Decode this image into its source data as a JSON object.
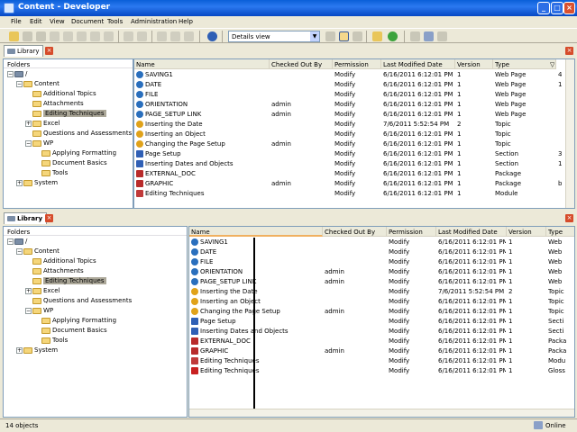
{
  "window": {
    "title": "Content - Developer"
  },
  "menu": [
    "File",
    "Edit",
    "View",
    "Document",
    "Tools",
    "Administration",
    "Help"
  ],
  "toolbar": {
    "view_select": "Details view"
  },
  "library_tab": "Library",
  "folders_header": "Folders",
  "tree": [
    {
      "label": "/",
      "level": 0,
      "expander": "−",
      "icon": "library"
    },
    {
      "label": "Content",
      "level": 1,
      "expander": "−",
      "icon": "folder"
    },
    {
      "label": "Additional Topics",
      "level": 2,
      "expander": "",
      "icon": "folder"
    },
    {
      "label": "Attachments",
      "level": 2,
      "expander": "",
      "icon": "folder"
    },
    {
      "label": "Editing Techniques",
      "level": 2,
      "expander": "",
      "icon": "folder",
      "selected": true
    },
    {
      "label": "Excel",
      "level": 2,
      "expander": "+",
      "icon": "folder"
    },
    {
      "label": "Questions and Assessments",
      "level": 2,
      "expander": "",
      "icon": "folder"
    },
    {
      "label": "WP",
      "level": 2,
      "expander": "−",
      "icon": "folder"
    },
    {
      "label": "Applying Formatting",
      "level": 3,
      "expander": "",
      "icon": "folder"
    },
    {
      "label": "Document Basics",
      "level": 3,
      "expander": "",
      "icon": "folder"
    },
    {
      "label": "Tools",
      "level": 3,
      "expander": "",
      "icon": "folder"
    },
    {
      "label": "System",
      "level": 1,
      "expander": "+",
      "icon": "folder"
    }
  ],
  "columns": [
    "Name",
    "Checked Out By",
    "Permission",
    "Last Modified Date",
    "Version",
    "Type"
  ],
  "rows_top": [
    {
      "name": "SAVING1",
      "checked": "",
      "perm": "Modify",
      "date": "6/16/2011 6:12:01 PM",
      "ver": "1",
      "type": "Web Page",
      "icon": "web",
      "lock": false
    },
    {
      "name": "DATE",
      "checked": "",
      "perm": "Modify",
      "date": "6/16/2011 6:12:01 PM",
      "ver": "1",
      "type": "Web Page",
      "icon": "web",
      "lock": false
    },
    {
      "name": "FILE",
      "checked": "",
      "perm": "Modify",
      "date": "6/16/2011 6:12:01 PM",
      "ver": "1",
      "type": "Web Page",
      "icon": "web",
      "lock": false
    },
    {
      "name": "ORIENTATION",
      "checked": "admin",
      "perm": "Modify",
      "date": "6/16/2011 6:12:01 PM",
      "ver": "1",
      "type": "Web Page",
      "icon": "web",
      "lock": true
    },
    {
      "name": "PAGE_SETUP LINK",
      "checked": "admin",
      "perm": "Modify",
      "date": "6/16/2011 6:12:01 PM",
      "ver": "1",
      "type": "Web Page",
      "icon": "web",
      "lock": true
    },
    {
      "name": "Inserting the Date",
      "checked": "",
      "perm": "Modify",
      "date": "7/6/2011 5:52:54 PM",
      "ver": "2",
      "type": "Topic",
      "icon": "topic",
      "lock": false
    },
    {
      "name": "Inserting an Object",
      "checked": "",
      "perm": "Modify",
      "date": "6/16/2011 6:12:01 PM",
      "ver": "1",
      "type": "Topic",
      "icon": "topic",
      "lock": false
    },
    {
      "name": "Changing the Page Setup",
      "checked": "admin",
      "perm": "Modify",
      "date": "6/16/2011 6:12:01 PM",
      "ver": "1",
      "type": "Topic",
      "icon": "topic",
      "lock": true
    },
    {
      "name": "Page Setup",
      "checked": "",
      "perm": "Modify",
      "date": "6/16/2011 6:12:01 PM",
      "ver": "1",
      "type": "Section",
      "icon": "section",
      "lock": false
    },
    {
      "name": "Inserting Dates and Objects",
      "checked": "",
      "perm": "Modify",
      "date": "6/16/2011 6:12:01 PM",
      "ver": "1",
      "type": "Section",
      "icon": "section",
      "lock": false
    },
    {
      "name": "EXTERNAL_DOC",
      "checked": "",
      "perm": "Modify",
      "date": "6/16/2011 6:12:01 PM",
      "ver": "1",
      "type": "Package",
      "icon": "package",
      "lock": false
    },
    {
      "name": "GRAPHIC",
      "checked": "admin",
      "perm": "Modify",
      "date": "6/16/2011 6:12:01 PM",
      "ver": "1",
      "type": "Package",
      "icon": "package",
      "lock": true
    },
    {
      "name": "Editing Techniques",
      "checked": "",
      "perm": "Modify",
      "date": "6/16/2011 6:12:01 PM",
      "ver": "1",
      "type": "Module",
      "icon": "module",
      "lock": false
    }
  ],
  "right_col_top": [
    "4",
    "1",
    "",
    "",
    "",
    "",
    "",
    "",
    "3",
    "1",
    "",
    "b",
    ""
  ],
  "rows_bottom": [
    {
      "name": "SAVING1",
      "checked": "",
      "perm": "Modify",
      "date": "6/16/2011 6:12:01 PM",
      "ver": "1",
      "type": "Web",
      "icon": "web",
      "lock": false
    },
    {
      "name": "DATE",
      "checked": "",
      "perm": "Modify",
      "date": "6/16/2011 6:12:01 PM",
      "ver": "1",
      "type": "Web",
      "icon": "web",
      "lock": false
    },
    {
      "name": "FILE",
      "checked": "",
      "perm": "Modify",
      "date": "6/16/2011 6:12:01 PM",
      "ver": "1",
      "type": "Web",
      "icon": "web",
      "lock": false
    },
    {
      "name": "ORIENTATION",
      "checked": "admin",
      "perm": "Modify",
      "date": "6/16/2011 6:12:01 PM",
      "ver": "1",
      "type": "Web",
      "icon": "web",
      "lock": true
    },
    {
      "name": "PAGE_SETUP LINK",
      "checked": "admin",
      "perm": "Modify",
      "date": "6/16/2011 6:12:01 PM",
      "ver": "1",
      "type": "Web",
      "icon": "web",
      "lock": true
    },
    {
      "name": "Inserting the Date",
      "checked": "",
      "perm": "Modify",
      "date": "7/6/2011 5:52:54 PM",
      "ver": "2",
      "type": "Topic",
      "icon": "topic",
      "lock": false
    },
    {
      "name": "Inserting an Object",
      "checked": "",
      "perm": "Modify",
      "date": "6/16/2011 6:12:01 PM",
      "ver": "1",
      "type": "Topic",
      "icon": "topic",
      "lock": false
    },
    {
      "name": "Changing the Page Setup",
      "checked": "admin",
      "perm": "Modify",
      "date": "6/16/2011 6:12:01 PM",
      "ver": "1",
      "type": "Topic",
      "icon": "topic",
      "lock": true
    },
    {
      "name": "Page Setup",
      "checked": "",
      "perm": "Modify",
      "date": "6/16/2011 6:12:01 PM",
      "ver": "1",
      "type": "Secti",
      "icon": "section",
      "lock": false
    },
    {
      "name": "Inserting Dates and Objects",
      "checked": "",
      "perm": "Modify",
      "date": "6/16/2011 6:12:01 PM",
      "ver": "1",
      "type": "Secti",
      "icon": "section",
      "lock": false
    },
    {
      "name": "EXTERNAL_DOC",
      "checked": "",
      "perm": "Modify",
      "date": "6/16/2011 6:12:01 PM",
      "ver": "1",
      "type": "Packa",
      "icon": "package",
      "lock": false
    },
    {
      "name": "GRAPHIC",
      "checked": "admin",
      "perm": "Modify",
      "date": "6/16/2011 6:12:01 PM",
      "ver": "1",
      "type": "Packa",
      "icon": "package",
      "lock": true
    },
    {
      "name": "Editing Techniques",
      "checked": "",
      "perm": "Modify",
      "date": "6/16/2011 6:12:01 PM",
      "ver": "1",
      "type": "Modu",
      "icon": "module",
      "lock": false
    },
    {
      "name": "Editing Techniques",
      "checked": "",
      "perm": "Modify",
      "date": "6/16/2011 6:12:01 PM",
      "ver": "1",
      "type": "Gloss",
      "icon": "glossary",
      "lock": false
    }
  ],
  "status": {
    "count": "14 objects",
    "online": "Online"
  },
  "icon_colors": {
    "web": "#2a6fbd",
    "topic": "#e0a21a",
    "section": "#2f5fb5",
    "package": "#b82b2b",
    "module": "#c03a3a",
    "glossary": "#c82020",
    "library": "#7a8da6"
  }
}
